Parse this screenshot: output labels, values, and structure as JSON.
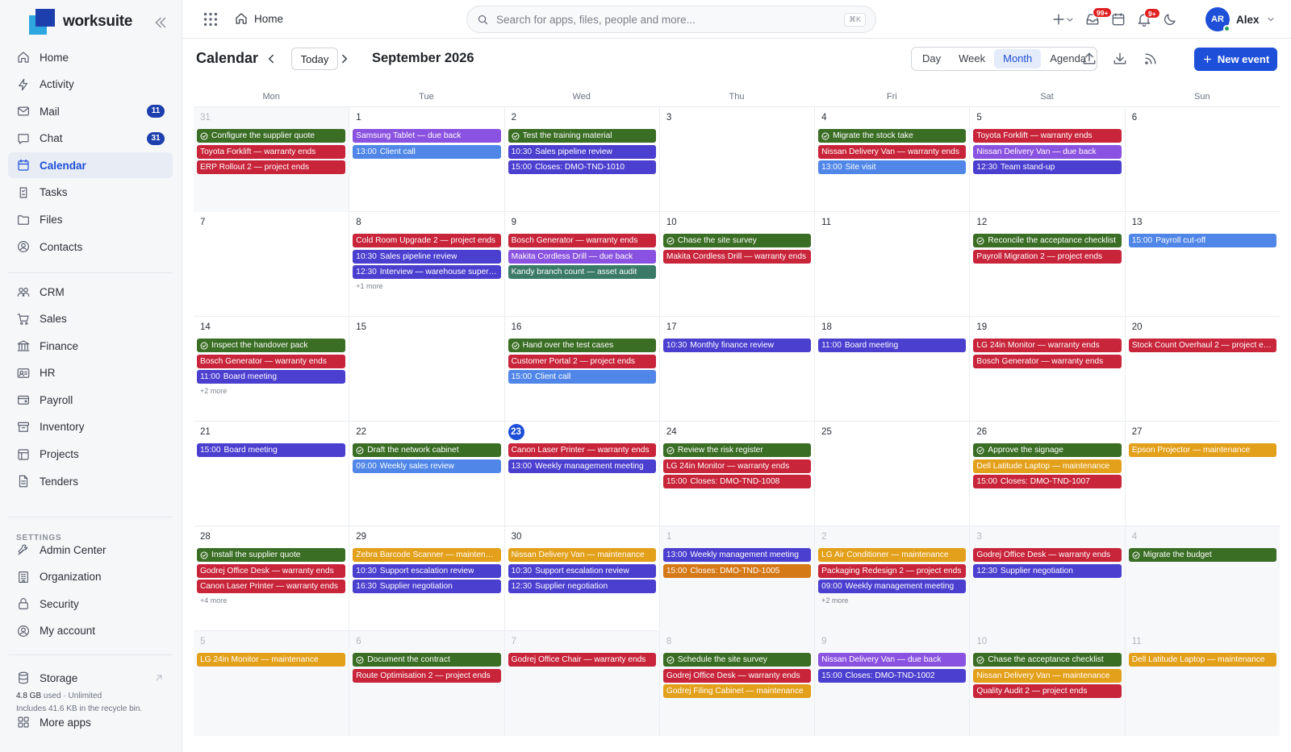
{
  "app": {
    "name": "worksuite"
  },
  "sidebar": {
    "items": [
      {
        "label": "Home",
        "icon": "home-icon"
      },
      {
        "label": "Activity",
        "icon": "activity-icon"
      },
      {
        "label": "Mail",
        "icon": "mail-icon",
        "badge": "11"
      },
      {
        "label": "Chat",
        "icon": "chat-icon",
        "badge": "31"
      },
      {
        "label": "Calendar",
        "icon": "calendar-icon",
        "active": true
      },
      {
        "label": "Tasks",
        "icon": "tasks-icon"
      },
      {
        "label": "Files",
        "icon": "folder-icon"
      },
      {
        "label": "Contacts",
        "icon": "contacts-icon"
      }
    ],
    "items2": [
      {
        "label": "CRM",
        "icon": "crm-icon"
      },
      {
        "label": "Sales",
        "icon": "cart-icon"
      },
      {
        "label": "Finance",
        "icon": "bank-icon"
      },
      {
        "label": "HR",
        "icon": "id-card-icon"
      },
      {
        "label": "Payroll",
        "icon": "wallet-icon"
      },
      {
        "label": "Inventory",
        "icon": "inventory-icon"
      },
      {
        "label": "Projects",
        "icon": "projects-icon"
      },
      {
        "label": "Tenders",
        "icon": "document-icon"
      }
    ],
    "settings_label": "SETTINGS",
    "settings": [
      {
        "label": "Admin Center",
        "icon": "admin-tools-icon"
      },
      {
        "label": "Organization",
        "icon": "building-icon"
      },
      {
        "label": "Security",
        "icon": "lock-icon"
      },
      {
        "label": "My account",
        "icon": "user-circle-icon"
      }
    ],
    "storage": {
      "title": "Storage",
      "used": "4.8 GB",
      "used_suffix": "used · Unlimited",
      "note": "Includes 41.6 KB in the recycle bin."
    },
    "more_apps": "More apps"
  },
  "topbar": {
    "breadcrumb": "Home",
    "search_placeholder": "Search for apps, files, people and more...",
    "shortcut": "⌘K",
    "notif_badge": "99+",
    "alerts_badge": "9+",
    "user_initials": "AR",
    "user_name": "Alex"
  },
  "calendar": {
    "title": "Calendar",
    "today_label": "Today",
    "month_label": "September 2026",
    "views": [
      "Day",
      "Week",
      "Month",
      "Agenda"
    ],
    "active_view": "Month",
    "new_event_label": "New event",
    "weekdays": [
      "Mon",
      "Tue",
      "Wed",
      "Thu",
      "Fri",
      "Sat",
      "Sun"
    ],
    "weeks": [
      [
        {
          "d": "31",
          "other": true,
          "events": [
            {
              "task": true,
              "title": "Configure the supplier quote",
              "color": "green"
            },
            {
              "title": "Toyota Forklift — warranty ends",
              "color": "red"
            },
            {
              "title": "ERP Rollout 2 — project ends",
              "color": "red"
            }
          ]
        },
        {
          "d": "1",
          "events": [
            {
              "title": "Samsung Tablet — due back",
              "color": "purple"
            },
            {
              "time": "13:00",
              "title": "Client call",
              "color": "blue"
            }
          ]
        },
        {
          "d": "2",
          "events": [
            {
              "task": true,
              "title": "Test the training material",
              "color": "green"
            },
            {
              "time": "10:30",
              "title": "Sales pipeline review",
              "color": "indigo"
            },
            {
              "time": "15:00",
              "title": "Closes: DMO-TND-1010",
              "color": "indigo"
            }
          ]
        },
        {
          "d": "3",
          "events": []
        },
        {
          "d": "4",
          "events": [
            {
              "task": true,
              "title": "Migrate the stock take",
              "color": "green"
            },
            {
              "title": "Nissan Delivery Van — warranty ends",
              "color": "red"
            },
            {
              "time": "13:00",
              "title": "Site visit",
              "color": "blue"
            }
          ]
        },
        {
          "d": "5",
          "events": [
            {
              "title": "Toyota Forklift — warranty ends",
              "color": "red"
            },
            {
              "title": "Nissan Delivery Van — due back",
              "color": "purple"
            },
            {
              "time": "12:30",
              "title": "Team stand-up",
              "color": "indigo"
            }
          ]
        },
        {
          "d": "6",
          "events": []
        }
      ],
      [
        {
          "d": "7",
          "events": []
        },
        {
          "d": "8",
          "more": "+1 more",
          "events": [
            {
              "title": "Cold Room Upgrade 2 — project ends",
              "color": "red"
            },
            {
              "time": "10:30",
              "title": "Sales pipeline review",
              "color": "indigo"
            },
            {
              "time": "12:30",
              "title": "Interview — warehouse supervisor",
              "color": "indigo"
            }
          ]
        },
        {
          "d": "9",
          "events": [
            {
              "title": "Bosch Generator — warranty ends",
              "color": "red"
            },
            {
              "title": "Makita Cordless Drill — due back",
              "color": "purple"
            },
            {
              "title": "Kandy branch count — asset audit",
              "color": "teal"
            }
          ]
        },
        {
          "d": "10",
          "events": [
            {
              "task": true,
              "title": "Chase the site survey",
              "color": "green"
            },
            {
              "title": "Makita Cordless Drill — warranty ends",
              "color": "red"
            }
          ]
        },
        {
          "d": "11",
          "events": []
        },
        {
          "d": "12",
          "events": [
            {
              "task": true,
              "title": "Reconcile the acceptance checklist",
              "color": "green"
            },
            {
              "title": "Payroll Migration 2 — project ends",
              "color": "red"
            }
          ]
        },
        {
          "d": "13",
          "events": [
            {
              "time": "15:00",
              "title": "Payroll cut-off",
              "color": "blue"
            }
          ]
        }
      ],
      [
        {
          "d": "14",
          "more": "+2 more",
          "events": [
            {
              "task": true,
              "title": "Inspect the handover pack",
              "color": "green"
            },
            {
              "title": "Bosch Generator — warranty ends",
              "color": "red"
            },
            {
              "time": "11:00",
              "title": "Board meeting",
              "color": "indigo"
            }
          ]
        },
        {
          "d": "15",
          "events": []
        },
        {
          "d": "16",
          "events": [
            {
              "task": true,
              "title": "Hand over the test cases",
              "color": "green"
            },
            {
              "title": "Customer Portal 2 — project ends",
              "color": "red"
            },
            {
              "time": "15:00",
              "title": "Client call",
              "color": "blue"
            }
          ]
        },
        {
          "d": "17",
          "events": [
            {
              "time": "10:30",
              "title": "Monthly finance review",
              "color": "indigo"
            }
          ]
        },
        {
          "d": "18",
          "events": [
            {
              "time": "11:00",
              "title": "Board meeting",
              "color": "indigo"
            }
          ]
        },
        {
          "d": "19",
          "events": [
            {
              "title": "LG 24in Monitor — warranty ends",
              "color": "red"
            },
            {
              "title": "Bosch Generator — warranty ends",
              "color": "red"
            }
          ]
        },
        {
          "d": "20",
          "events": [
            {
              "title": "Stock Count Overhaul 2 — project ends",
              "color": "red"
            }
          ]
        }
      ],
      [
        {
          "d": "21",
          "events": [
            {
              "time": "15:00",
              "title": "Board meeting",
              "color": "indigo"
            }
          ]
        },
        {
          "d": "22",
          "events": [
            {
              "task": true,
              "title": "Draft the network cabinet",
              "color": "green"
            },
            {
              "time": "09:00",
              "title": "Weekly sales review",
              "color": "blue"
            }
          ]
        },
        {
          "d": "23",
          "today": true,
          "events": [
            {
              "title": "Canon Laser Printer — warranty ends",
              "color": "red"
            },
            {
              "time": "13:00",
              "title": "Weekly management meeting",
              "color": "indigo"
            }
          ]
        },
        {
          "d": "24",
          "events": [
            {
              "task": true,
              "title": "Review the risk register",
              "color": "green"
            },
            {
              "title": "LG 24in Monitor — warranty ends",
              "color": "red"
            },
            {
              "time": "15:00",
              "title": "Closes: DMO-TND-1008",
              "color": "red"
            }
          ]
        },
        {
          "d": "25",
          "events": []
        },
        {
          "d": "26",
          "events": [
            {
              "task": true,
              "title": "Approve the signage",
              "color": "green"
            },
            {
              "title": "Dell Latitude Laptop — maintenance",
              "color": "orange"
            },
            {
              "time": "15:00",
              "title": "Closes: DMO-TND-1007",
              "color": "red"
            }
          ]
        },
        {
          "d": "27",
          "events": [
            {
              "title": "Epson Projector — maintenance",
              "color": "orange"
            }
          ]
        }
      ],
      [
        {
          "d": "28",
          "more": "+4 more",
          "events": [
            {
              "task": true,
              "title": "Install the supplier quote",
              "color": "green"
            },
            {
              "title": "Godrej Office Desk — warranty ends",
              "color": "red"
            },
            {
              "title": "Canon Laser Printer — warranty ends",
              "color": "red"
            }
          ]
        },
        {
          "d": "29",
          "events": [
            {
              "title": "Zebra Barcode Scanner — maintenance",
              "color": "orange"
            },
            {
              "time": "10:30",
              "title": "Support escalation review",
              "color": "indigo"
            },
            {
              "time": "16:30",
              "title": "Supplier negotiation",
              "color": "indigo"
            }
          ]
        },
        {
          "d": "30",
          "events": [
            {
              "title": "Nissan Delivery Van — maintenance",
              "color": "orange"
            },
            {
              "time": "10:30",
              "title": "Support escalation review",
              "color": "indigo"
            },
            {
              "time": "12:30",
              "title": "Supplier negotiation",
              "color": "indigo"
            }
          ]
        },
        {
          "d": "1",
          "other": true,
          "events": [
            {
              "time": "13:00",
              "title": "Weekly management meeting",
              "color": "indigo"
            },
            {
              "time": "15:00",
              "title": "Closes: DMO-TND-1005",
              "color": "dorange"
            }
          ]
        },
        {
          "d": "2",
          "other": true,
          "more": "+2 more",
          "events": [
            {
              "title": "LG Air Conditioner — maintenance",
              "color": "orange"
            },
            {
              "title": "Packaging Redesign 2 — project ends",
              "color": "red"
            },
            {
              "time": "09:00",
              "title": "Weekly management meeting",
              "color": "indigo"
            }
          ]
        },
        {
          "d": "3",
          "other": true,
          "events": [
            {
              "title": "Godrej Office Desk — warranty ends",
              "color": "red"
            },
            {
              "time": "12:30",
              "title": "Supplier negotiation",
              "color": "indigo"
            }
          ]
        },
        {
          "d": "4",
          "other": true,
          "events": [
            {
              "task": true,
              "title": "Migrate the budget",
              "color": "green"
            }
          ]
        }
      ],
      [
        {
          "d": "5",
          "other": true,
          "events": [
            {
              "title": "LG 24in Monitor — maintenance",
              "color": "orange"
            }
          ]
        },
        {
          "d": "6",
          "other": true,
          "events": [
            {
              "task": true,
              "title": "Document the contract",
              "color": "green"
            },
            {
              "title": "Route Optimisation 2 — project ends",
              "color": "red"
            }
          ]
        },
        {
          "d": "7",
          "other": true,
          "events": [
            {
              "title": "Godrej Office Chair — warranty ends",
              "color": "red"
            }
          ]
        },
        {
          "d": "8",
          "other": true,
          "events": [
            {
              "task": true,
              "title": "Schedule the site survey",
              "color": "green"
            },
            {
              "title": "Godrej Office Desk — warranty ends",
              "color": "red"
            },
            {
              "title": "Godrej Filing Cabinet — maintenance",
              "color": "orange"
            }
          ]
        },
        {
          "d": "9",
          "other": true,
          "events": [
            {
              "title": "Nissan Delivery Van — due back",
              "color": "purple"
            },
            {
              "time": "15:00",
              "title": "Closes: DMO-TND-1002",
              "color": "indigo"
            }
          ]
        },
        {
          "d": "10",
          "other": true,
          "events": [
            {
              "task": true,
              "title": "Chase the acceptance checklist",
              "color": "green"
            },
            {
              "title": "Nissan Delivery Van — maintenance",
              "color": "orange"
            },
            {
              "title": "Quality Audit 2 — project ends",
              "color": "red"
            }
          ]
        },
        {
          "d": "11",
          "other": true,
          "events": [
            {
              "title": "Dell Latitude Laptop — maintenance",
              "color": "orange"
            }
          ]
        }
      ]
    ]
  }
}
